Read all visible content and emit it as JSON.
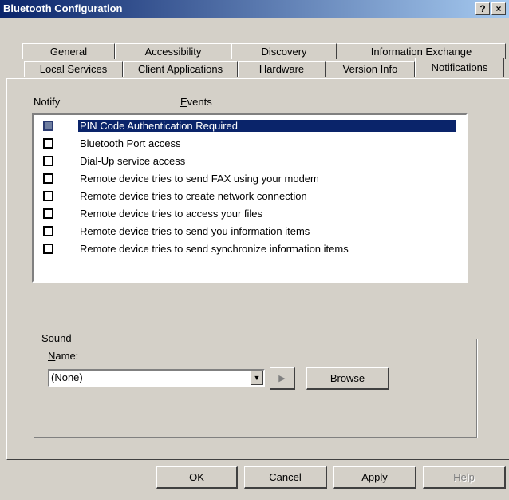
{
  "window": {
    "title": "Bluetooth Configuration",
    "help_glyph": "?",
    "close_glyph": "×"
  },
  "tabs_row1": [
    {
      "label": "General"
    },
    {
      "label": "Accessibility"
    },
    {
      "label": "Discovery"
    },
    {
      "label": "Information Exchange"
    }
  ],
  "tabs_row2": [
    {
      "label": "Local Services"
    },
    {
      "label": "Client Applications"
    },
    {
      "label": "Hardware"
    },
    {
      "label": "Version Info"
    },
    {
      "label": "Notifications",
      "active": true
    }
  ],
  "notifications": {
    "notify_header": "Notify",
    "events_header": "Events",
    "events": [
      {
        "label": "PIN Code Authentication Required",
        "checked": false,
        "selected": true
      },
      {
        "label": "Bluetooth Port access",
        "checked": false
      },
      {
        "label": "Dial-Up service access",
        "checked": false
      },
      {
        "label": "Remote device tries to send FAX using your modem",
        "checked": false
      },
      {
        "label": "Remote device tries to create network connection",
        "checked": false
      },
      {
        "label": "Remote device tries to access your files",
        "checked": false
      },
      {
        "label": "Remote device tries to send you information items",
        "checked": false
      },
      {
        "label": "Remote device tries to send synchronize information items",
        "checked": false
      }
    ]
  },
  "sound": {
    "group_label": "Sound",
    "name_label": "Name:",
    "selected_value": "(None)",
    "play_glyph": "▶",
    "browse_label": "Browse"
  },
  "buttons": {
    "ok": "OK",
    "cancel": "Cancel",
    "apply": "Apply",
    "help": "Help"
  }
}
